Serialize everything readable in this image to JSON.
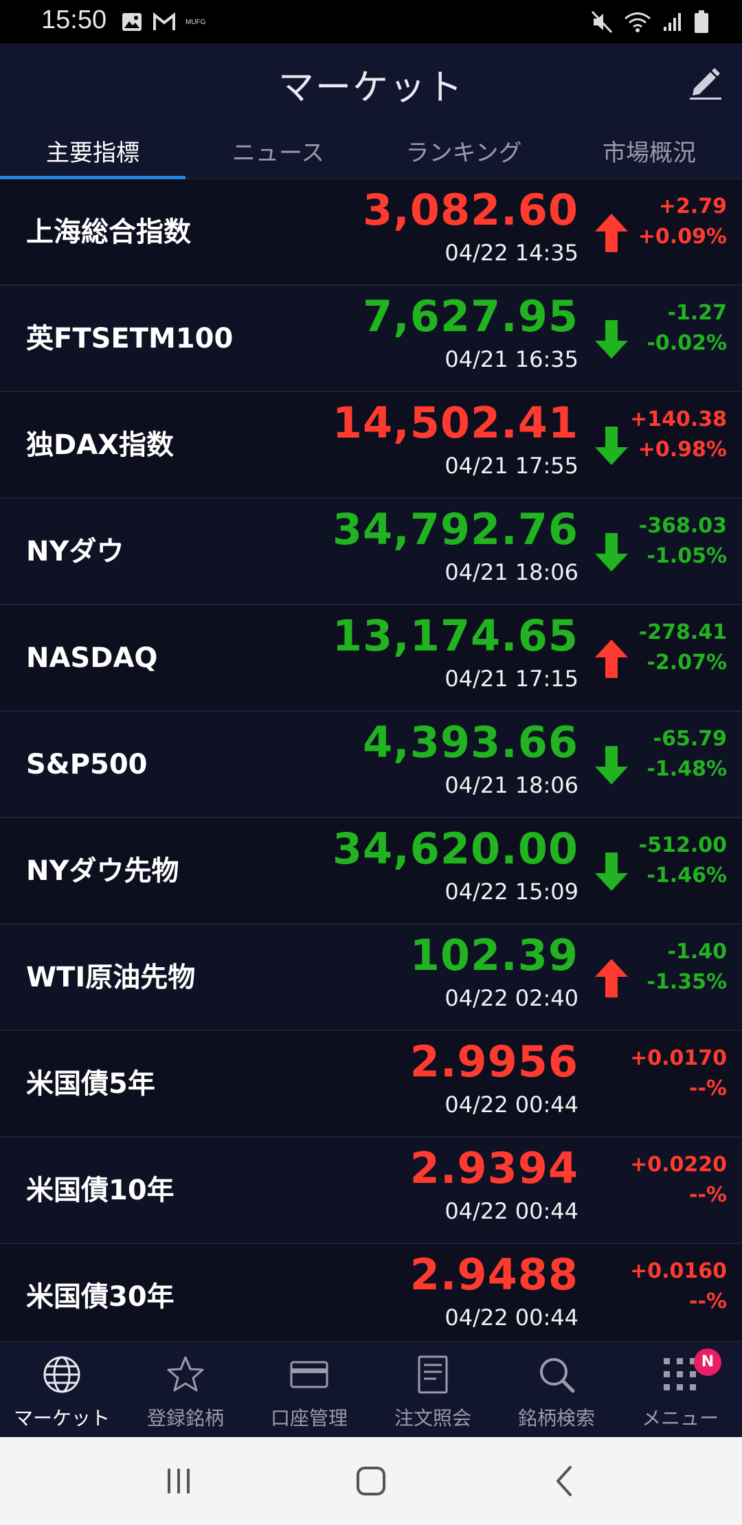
{
  "status_bar": {
    "time": "15:50",
    "carrier_label": "MUFG",
    "icons": [
      "image-icon",
      "gmail-icon",
      "mute-icon",
      "wifi-icon",
      "signal-icon",
      "battery-icon"
    ]
  },
  "header": {
    "title": "マーケット",
    "edit_icon": "pencil-icon"
  },
  "tabs": [
    {
      "label": "主要指標",
      "active": true
    },
    {
      "label": "ニュース",
      "active": false
    },
    {
      "label": "ランキング",
      "active": false
    },
    {
      "label": "市場概況",
      "active": false
    }
  ],
  "rows": [
    {
      "name": "上海総合指数",
      "price": "3,082.60",
      "time": "04/22 14:35",
      "change": "+2.79",
      "pct": "+0.09%",
      "price_color": "up",
      "change_color": "up",
      "arrow": "up"
    },
    {
      "name": "英FTSETM100",
      "price": "7,627.95",
      "time": "04/21 16:35",
      "change": "-1.27",
      "pct": "-0.02%",
      "price_color": "down",
      "change_color": "down",
      "arrow": "down"
    },
    {
      "name": "独DAX指数",
      "price": "14,502.41",
      "time": "04/21 17:55",
      "change": "+140.38",
      "pct": "+0.98%",
      "price_color": "up",
      "change_color": "up",
      "arrow": "down"
    },
    {
      "name": "NYダウ",
      "price": "34,792.76",
      "time": "04/21 18:06",
      "change": "-368.03",
      "pct": "-1.05%",
      "price_color": "down",
      "change_color": "down",
      "arrow": "down"
    },
    {
      "name": "NASDAQ",
      "price": "13,174.65",
      "time": "04/21 17:15",
      "change": "-278.41",
      "pct": "-2.07%",
      "price_color": "down",
      "change_color": "down",
      "arrow": "up"
    },
    {
      "name": "S&P500",
      "price": "4,393.66",
      "time": "04/21 18:06",
      "change": "-65.79",
      "pct": "-1.48%",
      "price_color": "down",
      "change_color": "down",
      "arrow": "down"
    },
    {
      "name": "NYダウ先物",
      "price": "34,620.00",
      "time": "04/22 15:09",
      "change": "-512.00",
      "pct": "-1.46%",
      "price_color": "down",
      "change_color": "down",
      "arrow": "down"
    },
    {
      "name": "WTI原油先物",
      "price": "102.39",
      "time": "04/22 02:40",
      "change": "-1.40",
      "pct": "-1.35%",
      "price_color": "down",
      "change_color": "down",
      "arrow": "up"
    },
    {
      "name": "米国債5年",
      "price": "2.9956",
      "time": "04/22 00:44",
      "change": "+0.0170",
      "pct": "--%",
      "price_color": "up",
      "change_color": "up",
      "arrow": "none"
    },
    {
      "name": "米国債10年",
      "price": "2.9394",
      "time": "04/22 00:44",
      "change": "+0.0220",
      "pct": "--%",
      "price_color": "up",
      "change_color": "up",
      "arrow": "none"
    },
    {
      "name": "米国債30年",
      "price": "2.9488",
      "time": "04/22 00:44",
      "change": "+0.0160",
      "pct": "--%",
      "price_color": "up",
      "change_color": "up",
      "arrow": "none"
    }
  ],
  "colors": {
    "up": "#ff3b30",
    "down": "#22b320",
    "accent": "#1e88e5",
    "background": "#0d0f1e",
    "badge": "#e91e63"
  },
  "bottom_nav": [
    {
      "label": "マーケット",
      "icon": "globe-icon",
      "active": true
    },
    {
      "label": "登録銘柄",
      "icon": "star-icon",
      "active": false
    },
    {
      "label": "口座管理",
      "icon": "card-icon",
      "active": false
    },
    {
      "label": "注文照会",
      "icon": "document-icon",
      "active": false
    },
    {
      "label": "銘柄検索",
      "icon": "search-icon",
      "active": false
    },
    {
      "label": "メニュー",
      "icon": "grid-icon",
      "active": false,
      "badge": "N"
    }
  ],
  "system_nav": [
    "recents-icon",
    "home-icon",
    "back-icon"
  ]
}
